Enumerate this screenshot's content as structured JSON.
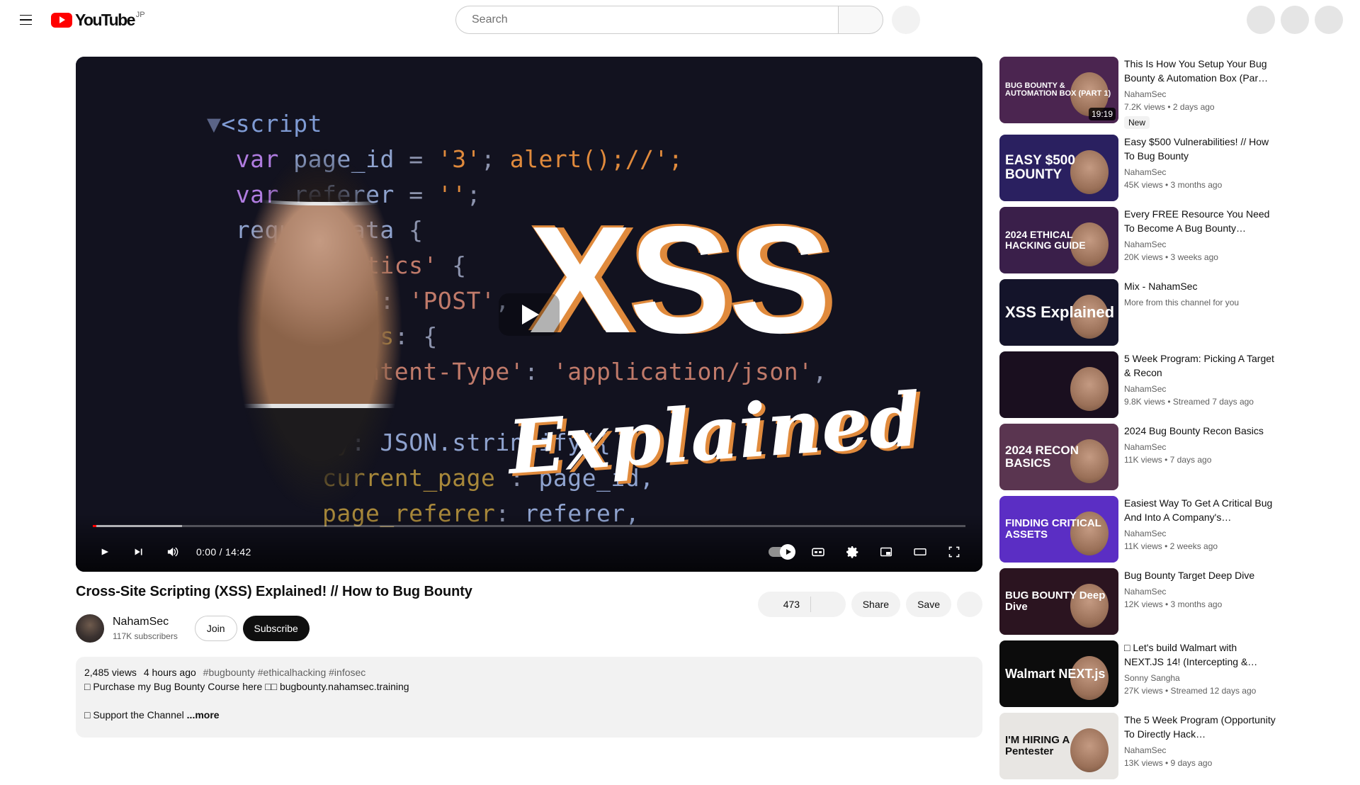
{
  "masthead": {
    "menu_label": "Guide",
    "logo_text": "YouTube",
    "logo_country": "JP",
    "search_placeholder": "Search",
    "search_value": "",
    "search_button_label": "Search",
    "voice_label": "Search with your voice",
    "right_buttons": [
      "create",
      "notifications",
      "avatar"
    ]
  },
  "player": {
    "time_display": "0:00 / 14:42",
    "current_time": "0:00",
    "duration": "14:42",
    "autoplay_state": "on",
    "progress_played_pct": 0.4,
    "progress_loaded_pct": 10.2,
    "thumbnail": {
      "title_main": "XSS",
      "title_script": "Explained",
      "code_lines": [
        "▼<script>",
        "  var page_id = '3'; alert();//';",
        "  var referer = '';",
        "  requestData {",
        "    '/analytics' {",
        "      method: 'POST',",
        "      headers: {",
        "        'Content-Type': 'application/json',",
        "      },",
        "      body: JSON.stringify({",
        "        current_page : page_id,",
        "        page_referer: referer,"
      ]
    },
    "controls": [
      "play-button",
      "next-button",
      "mute-button",
      "autoplay-toggle",
      "captions-button",
      "settings-button",
      "miniplayer-button",
      "theater-button",
      "fullscreen-button"
    ]
  },
  "video": {
    "title": "Cross-Site Scripting (XSS) Explained! // How to Bug Bounty",
    "channel": "NahamSec",
    "subscribers": "117K subscribers",
    "join_label": "Join",
    "subscribe_label": "Subscribe",
    "like_count": "473",
    "share_label": "Share",
    "save_label": "Save",
    "more_actions_label": "More actions"
  },
  "description": {
    "views": "2,485 views",
    "published": "4 hours ago",
    "hashtags": "#bugbounty #ethicalhacking #infosec",
    "line1": "□ Purchase my Bug Bounty Course here □□ bugbounty.nahamsec.training",
    "line2": "□ Support the Channel",
    "more_label": "...more"
  },
  "sidebar": {
    "items": [
      {
        "title": "This Is How You Setup Your Bug Bounty & Automation Box (Par…",
        "channel": "NahamSec",
        "views": "7.2K views",
        "age": "2 days ago",
        "duration": "19:19",
        "badge": "New",
        "thumb_text": "BUG BOUNTY & AUTOMATION BOX (PART 1)",
        "thumb_bg": "#4b2550",
        "thumb_fs": 11
      },
      {
        "title": "Easy $500 Vulnerabilities! // How To Bug Bounty",
        "channel": "NahamSec",
        "views": "45K views",
        "age": "3 months ago",
        "duration": "",
        "badge": "",
        "thumb_text": "EASY $500 BOUNTY",
        "thumb_bg": "#2a2060",
        "thumb_fs": 19
      },
      {
        "title": "Every FREE Resource You Need To Become A Bug Bounty…",
        "channel": "NahamSec",
        "views": "20K views",
        "age": "3 weeks ago",
        "duration": "",
        "badge": "",
        "thumb_text": "2024 ETHICAL HACKING GUIDE",
        "thumb_bg": "#3a1f4a",
        "thumb_fs": 14
      },
      {
        "title": "Mix - NahamSec",
        "channel": "More from this channel for you",
        "views": "",
        "age": "",
        "duration": "",
        "badge": "",
        "thumb_text": "XSS Explained",
        "thumb_bg": "#14142a",
        "thumb_fs": 22
      },
      {
        "title": "5 Week Program: Picking A Target & Recon",
        "channel": "NahamSec",
        "views": "9.8K views",
        "age": "Streamed 7 days ago",
        "duration": "",
        "badge": "",
        "thumb_text": "",
        "thumb_bg": "#1a0f1f",
        "thumb_fs": 12
      },
      {
        "title": "2024 Bug Bounty Recon Basics",
        "channel": "NahamSec",
        "views": "11K views",
        "age": "7 days ago",
        "duration": "",
        "badge": "",
        "thumb_text": "2024 RECON BASICS",
        "thumb_bg": "#5a3550",
        "thumb_fs": 17
      },
      {
        "title": "Easiest Way To Get A Critical Bug And Into A Company's…",
        "channel": "NahamSec",
        "views": "11K views",
        "age": "2 weeks ago",
        "duration": "",
        "badge": "",
        "thumb_text": "FINDING CRITICAL ASSETS",
        "thumb_bg": "#5b2ec4",
        "thumb_fs": 15
      },
      {
        "title": "Bug Bounty Target Deep Dive",
        "channel": "NahamSec",
        "views": "12K views",
        "age": "3 months ago",
        "duration": "",
        "badge": "",
        "thumb_text": "BUG BOUNTY Deep Dive",
        "thumb_bg": "#2b1420",
        "thumb_fs": 15
      },
      {
        "title": "□ Let's build Walmart with NEXT.JS 14! (Intercepting &…",
        "channel": "Sonny Sangha",
        "views": "27K views",
        "age": "Streamed 12 days ago",
        "duration": "",
        "badge": "",
        "thumb_text": "Walmart NEXT.js",
        "thumb_bg": "#0c0c0c",
        "thumb_fs": 18
      },
      {
        "title": "The 5 Week Program (Opportunity To Directly Hack…",
        "channel": "NahamSec",
        "views": "13K views",
        "age": "9 days ago",
        "duration": "",
        "badge": "",
        "thumb_text": "I'M HIRING A Pentester",
        "thumb_bg": "#e8e6e3",
        "thumb_fs": 15
      }
    ]
  }
}
